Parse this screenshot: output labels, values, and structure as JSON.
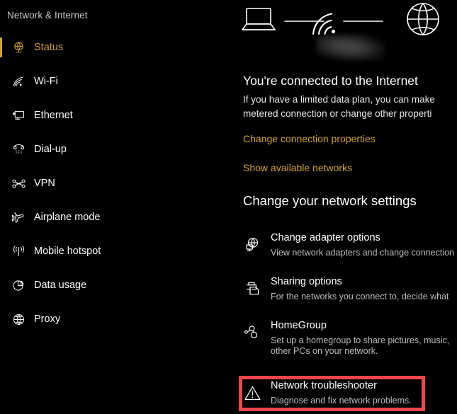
{
  "sidebar": {
    "title": "Network & Internet",
    "items": [
      {
        "label": "Status",
        "icon": "network-status-icon",
        "selected": true
      },
      {
        "label": "Wi-Fi",
        "icon": "wifi-icon",
        "selected": false
      },
      {
        "label": "Ethernet",
        "icon": "ethernet-icon",
        "selected": false
      },
      {
        "label": "Dial-up",
        "icon": "dialup-modem-icon",
        "selected": false
      },
      {
        "label": "VPN",
        "icon": "vpn-icon",
        "selected": false
      },
      {
        "label": "Airplane mode",
        "icon": "airplane-icon",
        "selected": false
      },
      {
        "label": "Mobile hotspot",
        "icon": "hotspot-icon",
        "selected": false
      },
      {
        "label": "Data usage",
        "icon": "pie-chart-icon",
        "selected": false
      },
      {
        "label": "Proxy",
        "icon": "globe-icon",
        "selected": false
      }
    ],
    "selected_accent_color": "#d0a32b"
  },
  "main": {
    "diagram": {
      "device_icon": "laptop-icon",
      "middle_icon": "wifi-signal-icon",
      "end_icon": "globe-icon",
      "network_name_redacted": true
    },
    "status_heading": "You're connected to the Internet",
    "status_description_line1": "If you have a limited data plan, you can make",
    "status_description_line2": "metered connection or change other properti",
    "links": [
      {
        "label": "Change connection properties",
        "name": "change-connection-properties-link"
      },
      {
        "label": "Show available networks",
        "name": "show-available-networks-link"
      }
    ],
    "settings_heading": "Change your network settings",
    "settings": [
      {
        "title": "Change adapter options",
        "description": "View network adapters and change connection",
        "description_2": "",
        "icon": "network-adapter-icon",
        "highlighted": false
      },
      {
        "title": "Sharing options",
        "description": "For the networks you connect to, decide what",
        "description_2": "",
        "icon": "sharing-printer-icon",
        "highlighted": false
      },
      {
        "title": "HomeGroup",
        "description": "Set up a homegroup to share pictures, music, ",
        "description_2": "other PCs on your network.",
        "icon": "homegroup-nodes-icon",
        "highlighted": false
      },
      {
        "title": "Network troubleshooter",
        "description": "Diagnose and fix network problems.",
        "description_2": "",
        "icon": "warning-triangle-icon",
        "highlighted": true
      }
    ],
    "highlight_color": "#f4464a"
  }
}
